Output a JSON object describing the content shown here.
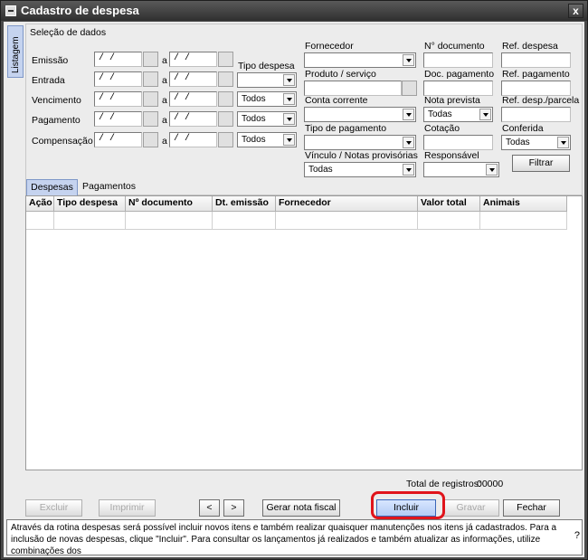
{
  "window": {
    "title": "Cadastro de despesa",
    "close_label": "x"
  },
  "side_tab": {
    "label": "Listagem"
  },
  "filters": {
    "section_title": "Seleção de dados",
    "date_rows": [
      {
        "label": "Emissão",
        "from": " / /",
        "sep": "a",
        "to": " / /"
      },
      {
        "label": "Entrada",
        "from": " / /",
        "sep": "a",
        "to": " / /"
      },
      {
        "label": "Vencimento",
        "from": " / /",
        "sep": "a",
        "to": " / /"
      },
      {
        "label": "Pagamento",
        "from": " / /",
        "sep": "a",
        "to": " / /"
      },
      {
        "label": "Compensação",
        "from": " / /",
        "sep": "a",
        "to": " / /"
      }
    ],
    "tipo_despesa": {
      "label": "Tipo despesa",
      "value": ""
    },
    "vencimento_select": "Todos",
    "pagamento_select": "Todos",
    "compensacao_select": "Todos",
    "fornecedor": {
      "label": "Fornecedor",
      "value": ""
    },
    "produto_servico": {
      "label": "Produto / serviço",
      "value": ""
    },
    "conta_corrente": {
      "label": "Conta corrente",
      "value": ""
    },
    "tipo_pagamento": {
      "label": "Tipo de pagamento",
      "value": ""
    },
    "vinculo": {
      "label": "Vínculo / Notas provisórias",
      "value": "Todas"
    },
    "n_documento": {
      "label": "N° documento",
      "value": ""
    },
    "doc_pagamento": {
      "label": "Doc. pagamento",
      "value": ""
    },
    "nota_prevista": {
      "label": "Nota prevista",
      "value": "Todas"
    },
    "cotacao": {
      "label": "Cotação",
      "value": ""
    },
    "responsavel": {
      "label": "Responsável",
      "value": ""
    },
    "ref_despesa": {
      "label": "Ref. despesa",
      "value": ""
    },
    "ref_pagamento": {
      "label": "Ref. pagamento",
      "value": ""
    },
    "ref_parcela": {
      "label": "Ref. desp./parcela",
      "value": ""
    },
    "conferida": {
      "label": "Conferida",
      "value": "Todas"
    },
    "filter_button": "Filtrar"
  },
  "tabs": [
    {
      "label": "Despesas",
      "active": true
    },
    {
      "label": "Pagamentos",
      "active": false
    }
  ],
  "grid": {
    "columns": [
      "Ação",
      "Tipo despesa",
      "Nº documento",
      "Dt. emissão",
      "Fornecedor",
      "Valor total",
      "Animais"
    ],
    "rows": []
  },
  "totals": {
    "label": "Total de registros:",
    "value": "00000"
  },
  "buttons": {
    "excluir": "Excluir",
    "imprimir": "Imprimir",
    "prev": "<",
    "next": ">",
    "gerar_nota": "Gerar nota fiscal",
    "incluir": "Incluir",
    "gravar": "Gravar",
    "fechar": "Fechar"
  },
  "help": {
    "text": "Através da rotina despesas será possível incluir novos itens e também realizar quaisquer manutenções nos itens já cadastrados. Para a inclusão de novas despesas, clique \"Incluir\". Para consultar os lançamentos já realizados e também atualizar as informações, utilize combinações dos",
    "qmark": "?"
  },
  "colors": {
    "highlight": "#e0141b",
    "accent": "#c5d3ef"
  }
}
